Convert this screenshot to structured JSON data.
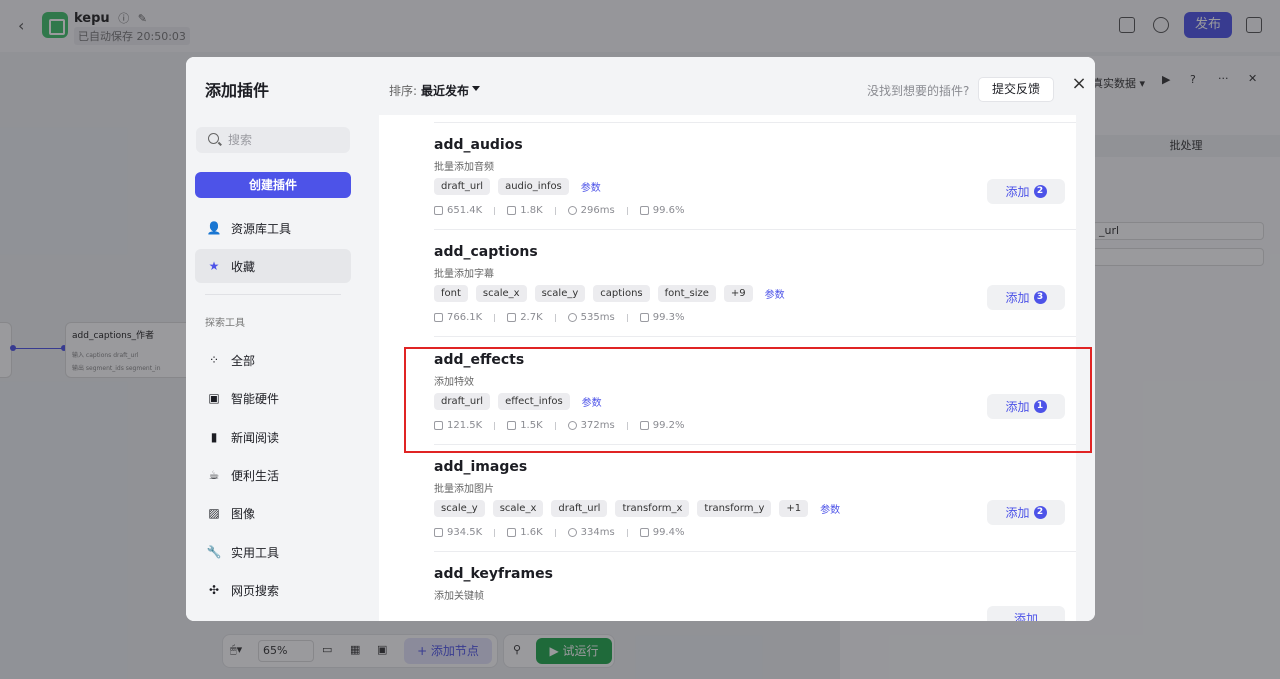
{
  "app": {
    "name": "kepu",
    "saved_status": "已自动保存 20:50:03",
    "publish_label": "发布"
  },
  "canvas": {
    "node_title": "add_captions_作者",
    "node_line1": "输入  captions  draft_url",
    "node_line2": "输出  segment_ids  segment_in"
  },
  "right_panel": {
    "dropdown_label": "真实数据 ▾",
    "batch_label": "批处理",
    "field1_value": "_url",
    "field2_value": ""
  },
  "bottom_toolbar": {
    "zoom": "65%",
    "add_node_label": "+  添加节点",
    "run_label": "▶  试运行"
  },
  "modal": {
    "title": "添加插件",
    "search_placeholder": "搜索",
    "create_label": "创建插件",
    "top_items": [
      {
        "label": "资源库工具",
        "icon": "person-icon"
      },
      {
        "label": "收藏",
        "icon": "star-icon"
      }
    ],
    "section_label": "探索工具",
    "categories": [
      {
        "label": "全部",
        "icon": "grid-icon"
      },
      {
        "label": "智能硬件",
        "icon": "chip-icon"
      },
      {
        "label": "新闻阅读",
        "icon": "book-icon"
      },
      {
        "label": "便利生活",
        "icon": "cup-icon"
      },
      {
        "label": "图像",
        "icon": "image-icon"
      },
      {
        "label": "实用工具",
        "icon": "wrench-icon"
      },
      {
        "label": "网页搜索",
        "icon": "network-icon"
      }
    ],
    "sort_label": "排序:",
    "sort_value": "最近发布",
    "not_found_text": "没找到想要的插件?",
    "feedback_label": "提交反馈",
    "params_label": "参数",
    "add_label": "添加",
    "plugins": [
      {
        "name": "add_audios",
        "desc": "批量添加音频",
        "tags": [
          "draft_url",
          "audio_infos"
        ],
        "stats": [
          "651.4K",
          "1.8K",
          "296ms",
          "99.6%"
        ],
        "badge": "2"
      },
      {
        "name": "add_captions",
        "desc": "批量添加字幕",
        "tags": [
          "font",
          "scale_x",
          "scale_y",
          "captions",
          "font_size",
          "+9"
        ],
        "stats": [
          "766.1K",
          "2.7K",
          "535ms",
          "99.3%"
        ],
        "badge": "3"
      },
      {
        "name": "add_effects",
        "desc": "添加特效",
        "tags": [
          "draft_url",
          "effect_infos"
        ],
        "stats": [
          "121.5K",
          "1.5K",
          "372ms",
          "99.2%"
        ],
        "badge": "1"
      },
      {
        "name": "add_images",
        "desc": "批量添加图片",
        "tags": [
          "scale_y",
          "scale_x",
          "draft_url",
          "transform_x",
          "transform_y",
          "+1"
        ],
        "stats": [
          "934.5K",
          "1.6K",
          "334ms",
          "99.4%"
        ],
        "badge": "2"
      },
      {
        "name": "add_keyframes",
        "desc": "添加关键帧",
        "tags": [],
        "stats": [],
        "badge": ""
      }
    ]
  },
  "colors": {
    "accent": "#4d53e8",
    "highlight": "#e02424",
    "run_green": "#20a84c"
  }
}
